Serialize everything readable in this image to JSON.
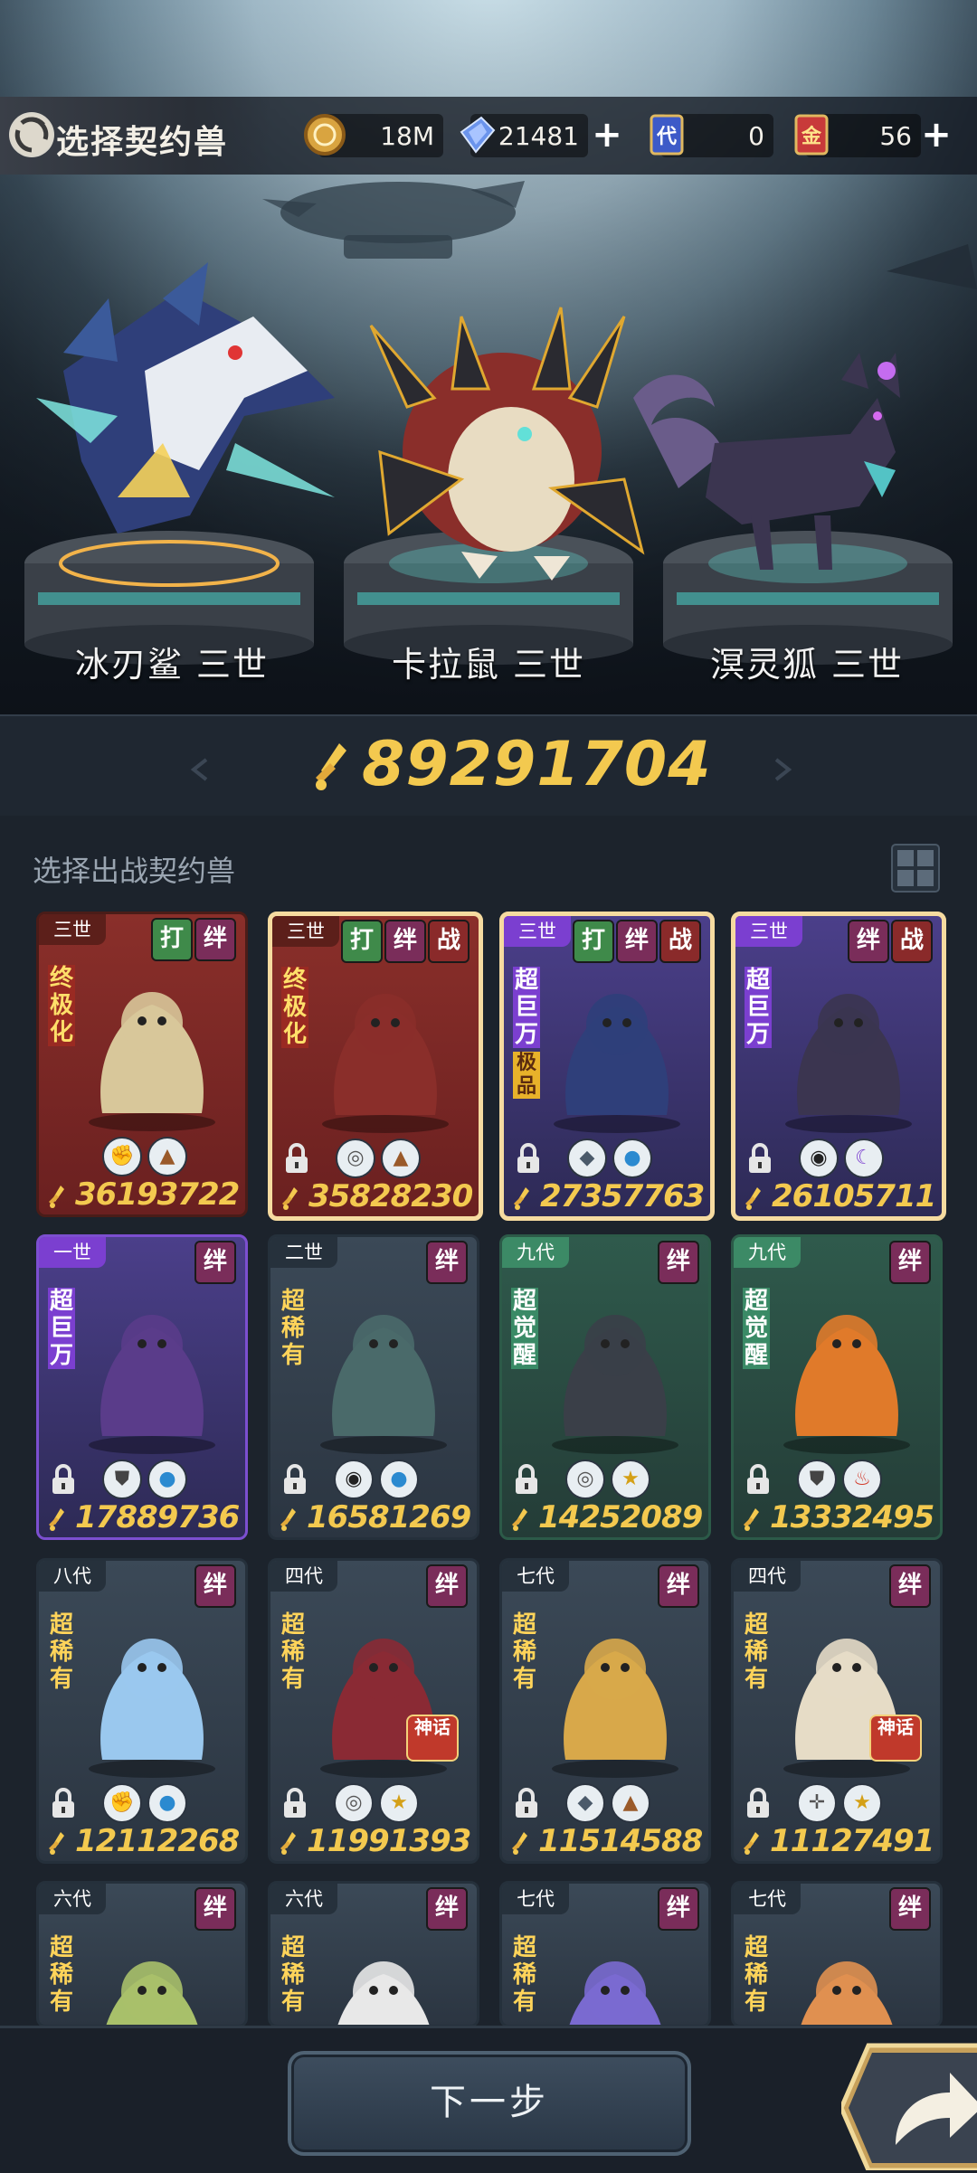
{
  "header": {
    "title": "选择契约兽",
    "resources": [
      {
        "name": "coin",
        "value": "18M",
        "icon": "coin-icon",
        "color": "#d9a440"
      },
      {
        "name": "crystal",
        "value": "21481",
        "icon": "blue-crystal-icon",
        "color": "#5a86e8",
        "has_plus": true
      },
      {
        "name": "ticket-dai",
        "value": "0",
        "icon": "blue-ticket-icon",
        "glyph": "代",
        "color": "#3d5ac8"
      },
      {
        "name": "ticket-jin",
        "value": "56",
        "icon": "red-ticket-icon",
        "glyph": "金",
        "color": "#c83a3a",
        "has_plus": true
      }
    ]
  },
  "team": [
    {
      "name": "冰刃鲨 三世"
    },
    {
      "name": "卡拉鼠 三世"
    },
    {
      "name": "溟灵狐 三世"
    }
  ],
  "total_power": "89291704",
  "list_title": "选择出战契约兽",
  "beasts": [
    {
      "gen": "三世",
      "rank": "终极化",
      "power": "36193722",
      "tags": [
        "打",
        "绊"
      ],
      "elements": [
        "fist-icon",
        "earth-icon"
      ],
      "frame": "red",
      "locked": false
    },
    {
      "gen": "三世",
      "rank": "终极化",
      "power": "35828230",
      "tags": [
        "打",
        "绊",
        "战"
      ],
      "elements": [
        "shield-ring-icon",
        "earth-icon"
      ],
      "frame": "red-selected",
      "locked": true
    },
    {
      "gen": "三世",
      "rank": "超巨万",
      "sub": "极品",
      "power": "27357763",
      "tags": [
        "打",
        "绊",
        "战"
      ],
      "elements": [
        "blade-icon",
        "water-icon"
      ],
      "frame": "purple-selected",
      "locked": true
    },
    {
      "gen": "三世",
      "rank": "超巨万",
      "power": "26105711",
      "tags": [
        "绊",
        "战"
      ],
      "elements": [
        "eye-icon",
        "moon-icon"
      ],
      "frame": "purple-selected",
      "locked": true
    },
    {
      "gen": "一世",
      "rank": "超巨万",
      "power": "17889736",
      "tags": [
        "绊"
      ],
      "elements": [
        "shield-icon",
        "water-icon"
      ],
      "frame": "purple",
      "locked": true
    },
    {
      "gen": "二世",
      "rank": "超稀有",
      "power": "16581269",
      "tags": [
        "绊"
      ],
      "elements": [
        "eye-icon",
        "water-icon"
      ],
      "frame": "gray",
      "locked": true
    },
    {
      "gen": "九代",
      "rank": "超觉醒",
      "power": "14252089",
      "tags": [
        "绊"
      ],
      "elements": [
        "shield-ring-icon",
        "star-icon"
      ],
      "frame": "green",
      "locked": true
    },
    {
      "gen": "九代",
      "rank": "超觉醒",
      "power": "13332495",
      "tags": [
        "绊"
      ],
      "elements": [
        "shield-icon",
        "fire-icon"
      ],
      "frame": "green",
      "locked": true
    },
    {
      "gen": "八代",
      "rank": "超稀有",
      "power": "12112268",
      "tags": [
        "绊"
      ],
      "elements": [
        "fist-icon",
        "water-icon"
      ],
      "frame": "gray",
      "locked": true
    },
    {
      "gen": "四代",
      "rank": "超稀有",
      "power": "11991393",
      "tags": [
        "绊"
      ],
      "elements": [
        "shield-ring-icon",
        "star-icon"
      ],
      "frame": "gray",
      "locked": true,
      "badge": "神话"
    },
    {
      "gen": "七代",
      "rank": "超稀有",
      "power": "11514588",
      "tags": [
        "绊"
      ],
      "elements": [
        "blade-icon",
        "earth-icon"
      ],
      "frame": "gray",
      "locked": true
    },
    {
      "gen": "四代",
      "rank": "超稀有",
      "power": "11127491",
      "tags": [
        "绊"
      ],
      "elements": [
        "crosshair-icon",
        "star-icon"
      ],
      "frame": "gray",
      "locked": true,
      "badge": "神话"
    },
    {
      "gen": "六代",
      "rank": "超稀有",
      "power": "",
      "tags": [
        "绊"
      ],
      "elements": [],
      "frame": "gray",
      "locked": false
    },
    {
      "gen": "六代",
      "rank": "超稀有",
      "power": "",
      "tags": [
        "绊"
      ],
      "elements": [],
      "frame": "gray",
      "locked": false
    },
    {
      "gen": "七代",
      "rank": "超稀有",
      "power": "",
      "tags": [
        "绊"
      ],
      "elements": [],
      "frame": "gray",
      "locked": false
    },
    {
      "gen": "七代",
      "rank": "超稀有",
      "power": "",
      "tags": [
        "绊"
      ],
      "elements": [],
      "frame": "gray",
      "locked": false
    }
  ],
  "next_button": "下一步",
  "colors": {
    "power_gold": "#f3c94f",
    "tag_da": "#3f8a4a",
    "tag_ban": "#7a2d5a",
    "tag_zhan": "#8a2a2a"
  }
}
